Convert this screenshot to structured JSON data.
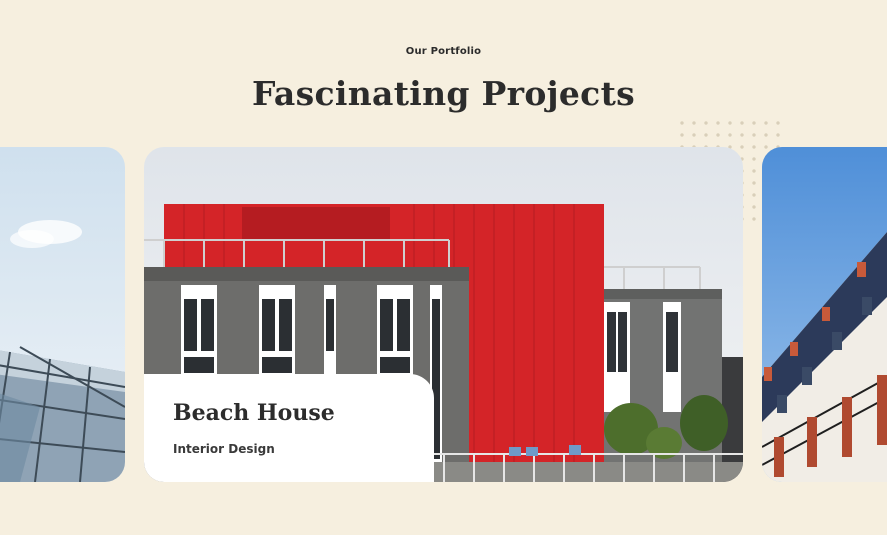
{
  "section": {
    "eyebrow": "Our Portfolio",
    "title": "Fascinating Projects"
  },
  "projects": [
    {
      "title": "",
      "category": "",
      "image": "glass-roof-building"
    },
    {
      "title": "Beach House",
      "category": "Interior Design",
      "image": "red-grey-modern-building"
    },
    {
      "title": "",
      "category": "",
      "image": "parisian-apartment-building"
    }
  ],
  "colors": {
    "background": "#f6efdf",
    "heading": "#2c2c2c",
    "accent_red": "#d9252b",
    "card_caption_bg": "#ffffff"
  }
}
